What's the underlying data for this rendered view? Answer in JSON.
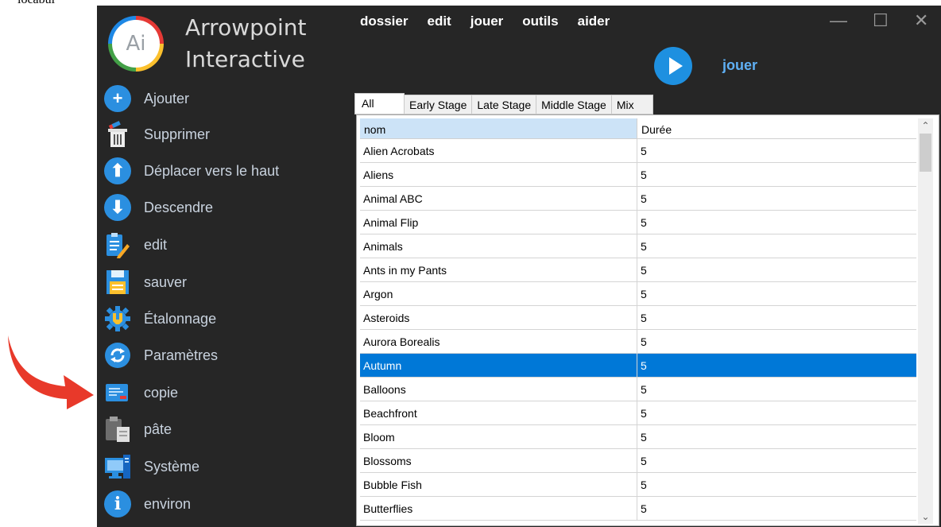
{
  "page": {
    "cropped_text": "iocabul"
  },
  "app": {
    "logo_text": "Ai",
    "brand_line1": "Arrowpoint",
    "brand_line2": "Interactive"
  },
  "sidebar": {
    "items": [
      {
        "label": "Ajouter",
        "icon": "plus-circle-icon"
      },
      {
        "label": "Supprimer",
        "icon": "trash-icon"
      },
      {
        "label": "Déplacer vers le haut",
        "icon": "arrow-up-circle-icon"
      },
      {
        "label": "Descendre",
        "icon": "arrow-down-circle-icon"
      },
      {
        "label": "edit",
        "icon": "edit-document-icon"
      },
      {
        "label": "sauver",
        "icon": "save-icon"
      },
      {
        "label": "Étalonnage",
        "icon": "gear-calibration-icon"
      },
      {
        "label": "Paramètres",
        "icon": "refresh-circle-icon"
      },
      {
        "label": "copie",
        "icon": "copy-icon"
      },
      {
        "label": "pâte",
        "icon": "paste-icon"
      },
      {
        "label": "Système",
        "icon": "system-monitor-icon"
      },
      {
        "label": "environ",
        "icon": "info-circle-icon"
      }
    ]
  },
  "menu": {
    "items": [
      "dossier",
      "edit",
      "jouer",
      "outils",
      "aider"
    ]
  },
  "window_controls": {
    "minimize": "—",
    "maximize": "☐",
    "close": "✕"
  },
  "player": {
    "play_label": "jouer"
  },
  "tabs": [
    "All",
    "Early Stage",
    "Late Stage",
    "Middle Stage",
    "Mix"
  ],
  "grid": {
    "columns": [
      "nom",
      "Durée"
    ],
    "rows": [
      [
        "Alien Acrobats",
        "5"
      ],
      [
        "Aliens",
        "5"
      ],
      [
        "Animal ABC",
        "5"
      ],
      [
        "Animal Flip",
        "5"
      ],
      [
        "Animals",
        "5"
      ],
      [
        "Ants in my Pants",
        "5"
      ],
      [
        "Argon",
        "5"
      ],
      [
        "Asteroids",
        "5"
      ],
      [
        "Aurora Borealis",
        "5"
      ],
      [
        "Autumn",
        "5"
      ],
      [
        "Balloons",
        "5"
      ],
      [
        "Beachfront",
        "5"
      ],
      [
        "Bloom",
        "5"
      ],
      [
        "Blossoms",
        "5"
      ],
      [
        "Bubble Fish",
        "5"
      ],
      [
        "Butterflies",
        "5"
      ]
    ],
    "selected_row": "Autumn"
  },
  "colors": {
    "app_bg": "#262626",
    "accent_blue": "#1e90e0",
    "selection": "#0078d7",
    "header_highlight": "#cce3f7",
    "annotation_arrow": "#e8392a"
  }
}
